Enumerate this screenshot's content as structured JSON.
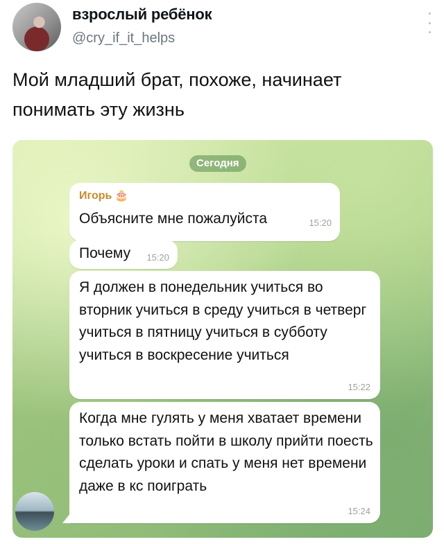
{
  "tweet": {
    "display_name": "взрослый ребёнок",
    "handle": "@cry_if_it_helps",
    "text_line1": "Мой младший брат, похоже, начинает",
    "text_line2": "понимать эту жизнь"
  },
  "chat": {
    "date_label": "Сегодня",
    "messages": [
      {
        "sender": "Игорь",
        "sender_icon": "cake-icon",
        "text": "Объясните мне пожалуйста",
        "time": "15:20"
      },
      {
        "text": "Почему",
        "time": "15:20"
      },
      {
        "text": "Я должен в понедельник учиться во вторник учиться в среду учиться в четверг учиться в пятницу учиться в субботу учиться в воскресение учиться",
        "time": "15:22"
      },
      {
        "text": "Когда мне гулять у меня хватает времени только встать пойти в школу прийти поесть сделать уроки и спать у меня нет времени даже в кс поиграть",
        "time": "15:24"
      }
    ]
  },
  "colors": {
    "sender_name": "#c98a2a",
    "bubble": "#ffffff",
    "chat_bg": "#a6cd86"
  }
}
